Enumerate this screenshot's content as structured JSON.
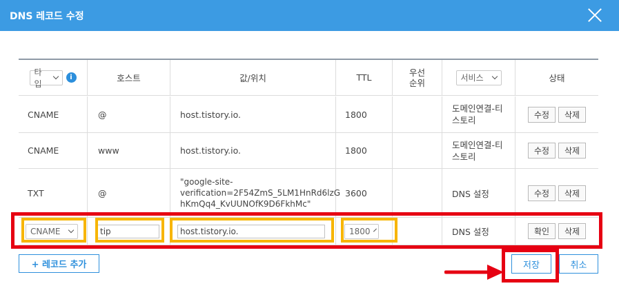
{
  "dialog": {
    "title": "DNS 레코드 수정"
  },
  "header": {
    "type_select": "타입",
    "info_icon": "i",
    "host": "호스트",
    "value": "값/위치",
    "ttl": "TTL",
    "priority_line1": "우선",
    "priority_line2": "순위",
    "service_select": "서비스",
    "status": "상태"
  },
  "rows": [
    {
      "type": "CNAME",
      "host": "@",
      "value": "host.tistory.io.",
      "ttl": "1800",
      "priority": "",
      "service_line1": "도메인연결-티",
      "service_line2": "스토리",
      "btn1": "수정",
      "btn2": "삭제"
    },
    {
      "type": "CNAME",
      "host": "www",
      "value": "host.tistory.io.",
      "ttl": "1800",
      "priority": "",
      "service_line1": "도메인연결-티",
      "service_line2": "스토리",
      "btn1": "수정",
      "btn2": "삭제"
    },
    {
      "type": "TXT",
      "host": "@",
      "value_line1": "\"google-site-",
      "value_line2": "verification=2F54ZmS_5LM1HnRd6lzG",
      "value_line3": "hKmQq4_KvUUNOfK9D6FkhMc\"",
      "ttl": "3600",
      "priority": "",
      "service": "DNS 설정",
      "btn1": "수정",
      "btn2": "삭제"
    }
  ],
  "edit_row": {
    "type": "CNAME",
    "host": "tip",
    "value": "host.tistory.io.",
    "ttl": "1800",
    "service": "DNS 설정",
    "btn1": "확인",
    "btn2": "삭제"
  },
  "footer": {
    "add_record": "+ 레코드 추가",
    "save": "저장",
    "cancel": "취소"
  },
  "colors": {
    "titlebar": "#3c9be3",
    "highlight_red": "#e60012",
    "highlight_yellow": "#f7b500",
    "accent": "#2c8fdc"
  }
}
